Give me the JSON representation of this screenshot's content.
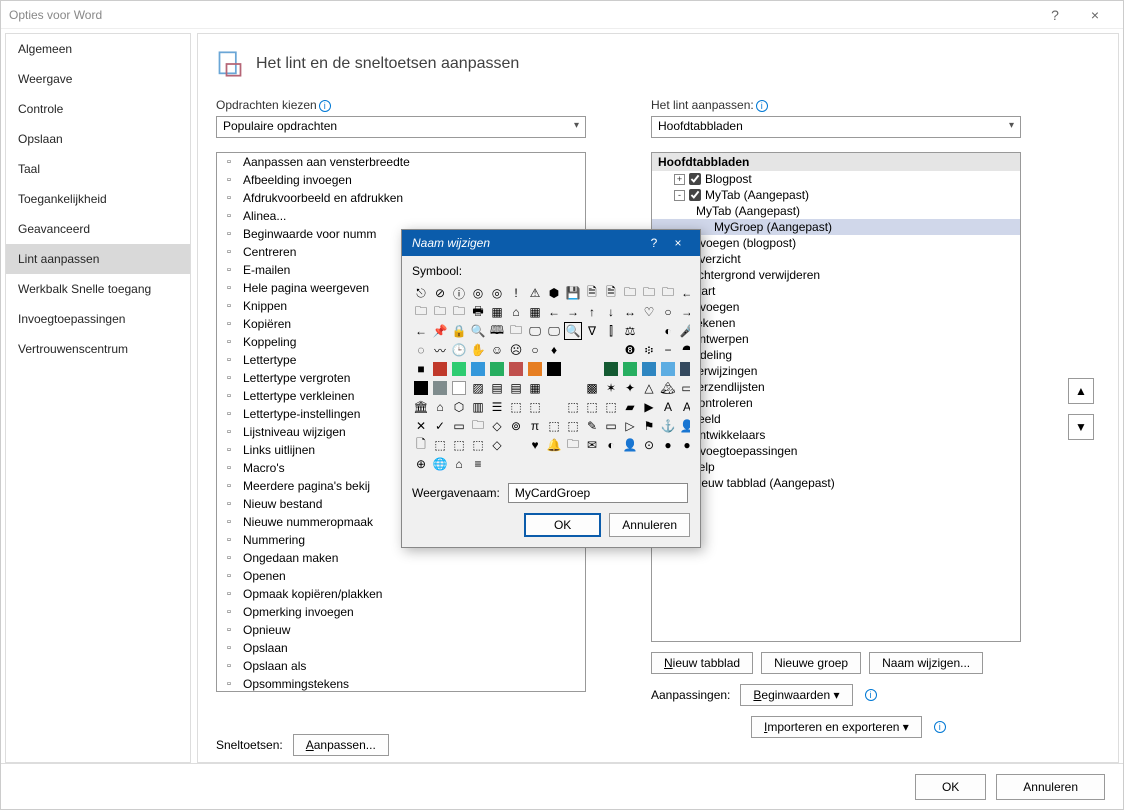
{
  "window": {
    "title": "Opties voor Word",
    "help": "?",
    "close": "×"
  },
  "sidebar": {
    "items": [
      "Algemeen",
      "Weergave",
      "Controle",
      "Opslaan",
      "Taal",
      "Toegankelijkheid",
      "Geavanceerd",
      "Lint aanpassen",
      "Werkbalk Snelle toegang",
      "Invoegtoepassingen",
      "Vertrouwenscentrum"
    ],
    "selected_index": 7
  },
  "header": {
    "title": "Het lint en de sneltoetsen aanpassen"
  },
  "left": {
    "label": "Opdrachten kiezen",
    "dropdown": "Populaire opdrachten",
    "commands": [
      "Aanpassen aan vensterbreedte",
      "Afbeelding invoegen",
      "Afdrukvoorbeeld en afdrukken",
      "Alinea...",
      "Beginwaarde voor numm",
      "Centreren",
      "E-mailen",
      "Hele pagina weergeven",
      "Knippen",
      "Kopiëren",
      "Koppeling",
      "Lettertype",
      "Lettertype vergroten",
      "Lettertype verkleinen",
      "Lettertype-instellingen",
      "Lijstniveau wijzigen",
      "Links uitlijnen",
      "Macro's",
      "Meerdere pagina's bekij",
      "Nieuw bestand",
      "Nieuwe nummeropmaak",
      "Nummering",
      "Ongedaan maken",
      "Openen",
      "Opmaak kopiëren/plakken",
      "Opmerking invoegen",
      "Opnieuw",
      "Opslaan",
      "Opslaan als",
      "Opsommingstekens"
    ]
  },
  "right": {
    "label": "Het lint aanpassen:",
    "dropdown": "Hoofdtabbladen",
    "tree_header": "Hoofdtabbladen",
    "nodes": [
      {
        "indent": 1,
        "expand": "+",
        "checked": true,
        "label": "Blogpost"
      },
      {
        "indent": 1,
        "expand": "-",
        "checked": true,
        "label": "MyTab (Aangepast)"
      },
      {
        "indent": 2,
        "expand": null,
        "checked": null,
        "label": "MyTab (Aangepast)"
      },
      {
        "indent": 3,
        "expand": null,
        "checked": null,
        "label": "MyGroep (Aangepast)",
        "selected": true
      },
      {
        "indent": 1,
        "expand": null,
        "checked": true,
        "label": "Invoegen (blogpost)"
      },
      {
        "indent": 1,
        "expand": null,
        "checked": true,
        "label": "Overzicht"
      },
      {
        "indent": 1,
        "expand": null,
        "checked": true,
        "label": "Achtergrond verwijderen"
      },
      {
        "indent": 1,
        "expand": null,
        "checked": true,
        "label": "Start"
      },
      {
        "indent": 1,
        "expand": null,
        "checked": true,
        "label": "Invoegen"
      },
      {
        "indent": 1,
        "expand": null,
        "checked": false,
        "label": "Tekenen"
      },
      {
        "indent": 1,
        "expand": null,
        "checked": true,
        "label": "Ontwerpen"
      },
      {
        "indent": 1,
        "expand": null,
        "checked": true,
        "label": "Indeling"
      },
      {
        "indent": 1,
        "expand": null,
        "checked": true,
        "label": "Verwijzingen"
      },
      {
        "indent": 1,
        "expand": null,
        "checked": true,
        "label": "Verzendlijsten"
      },
      {
        "indent": 1,
        "expand": null,
        "checked": true,
        "label": "Controleren"
      },
      {
        "indent": 1,
        "expand": null,
        "checked": true,
        "label": "Beeld"
      },
      {
        "indent": 1,
        "expand": null,
        "checked": false,
        "label": "Ontwikkelaars"
      },
      {
        "indent": 1,
        "expand": null,
        "checked": true,
        "label": "Invoegtoepassingen"
      },
      {
        "indent": 1,
        "expand": null,
        "checked": true,
        "label": "Help"
      },
      {
        "indent": 1,
        "expand": null,
        "checked": true,
        "label": "Nieuw tabblad (Aangepast)"
      }
    ],
    "buttons": {
      "new_tab": "Nieuw tabblad",
      "new_group": "Nieuwe groep",
      "rename": "Naam wijzigen..."
    },
    "custom_label": "Aanpassingen:",
    "reset": "Beginwaarden ▾",
    "import": "Importeren en exporteren ▾"
  },
  "sneltoets": {
    "label": "Sneltoetsen:",
    "button": "Aanpassen..."
  },
  "footer": {
    "ok": "OK",
    "cancel": "Annuleren"
  },
  "dialog": {
    "title": "Naam wijzigen",
    "help": "?",
    "close": "×",
    "symbol_label": "Symbool:",
    "display_label": "Weergavenaam:",
    "display_value": "MyCardGroep",
    "ok": "OK",
    "cancel": "Annuleren",
    "selected_index": 38,
    "symbols": [
      "⎋",
      "⊘",
      "ⓘ",
      "◎",
      "◎",
      "!",
      "⚠",
      "⬢",
      "💾",
      "🗎",
      "🗎",
      "🗀",
      "🗀",
      "🗀",
      "←",
      "🗀",
      "🗀",
      "🗀",
      "🖶",
      "▦",
      "⌂",
      "▦",
      "←",
      "→",
      "↑",
      "↓",
      "↔",
      "♡",
      "○",
      "→",
      "←",
      "📌",
      "🔒",
      "🔍",
      "🕮",
      "🗀",
      "🖵",
      "🖵",
      "🔍",
      "∇",
      "⫿",
      "⚖",
      "",
      "◐",
      "🎤",
      "◌",
      "〰",
      "🕒",
      "✋",
      "☺",
      "☹",
      "○",
      "♦",
      "",
      "",
      "",
      "❽",
      "፨",
      "−",
      "⯊",
      "■",
      "■",
      "■",
      "■",
      "■",
      "■",
      "■",
      "",
      "",
      "",
      "■",
      "■",
      "■",
      "■",
      "■",
      "■",
      "■",
      "☐",
      "▨",
      "▤",
      "▤",
      "▦",
      "",
      "",
      "▩",
      "✶",
      "✦",
      "△",
      "🏔",
      "▭",
      "🏛",
      "⌂",
      "⬡",
      "▥",
      "☰",
      "⬚",
      "⬚",
      "",
      "⬚",
      "⬚",
      "⬚",
      "▰",
      "▶",
      "A",
      "A",
      "✕",
      "✓",
      "▭",
      "🗀",
      "◇",
      "⊚",
      "π",
      "⬚",
      "⬚",
      "✎",
      "▭",
      "▷",
      "⚑",
      "⚓",
      "👤",
      "🗋",
      "⬚",
      "⬚",
      "⬚",
      "◇",
      "",
      "♥",
      "🔔",
      "🗀",
      "✉",
      "◐",
      "👤",
      "⊙",
      "●",
      "●",
      "⊕",
      "🌐",
      "⌂",
      "≡",
      ""
    ],
    "symbol_colors": {
      "61": "#c0392b",
      "62": "#2ecc71",
      "63": "#3498db",
      "64": "#27ae60",
      "65": "#c0504d",
      "66": "#e67e22",
      "67": "#000000",
      "70": "#145a32",
      "71": "#27ae60",
      "72": "#2e86c1",
      "73": "#5dade2",
      "74": "#34495e",
      "75": "#000000",
      "76": "#7f8c8d",
      "77": "#ffffff"
    }
  }
}
